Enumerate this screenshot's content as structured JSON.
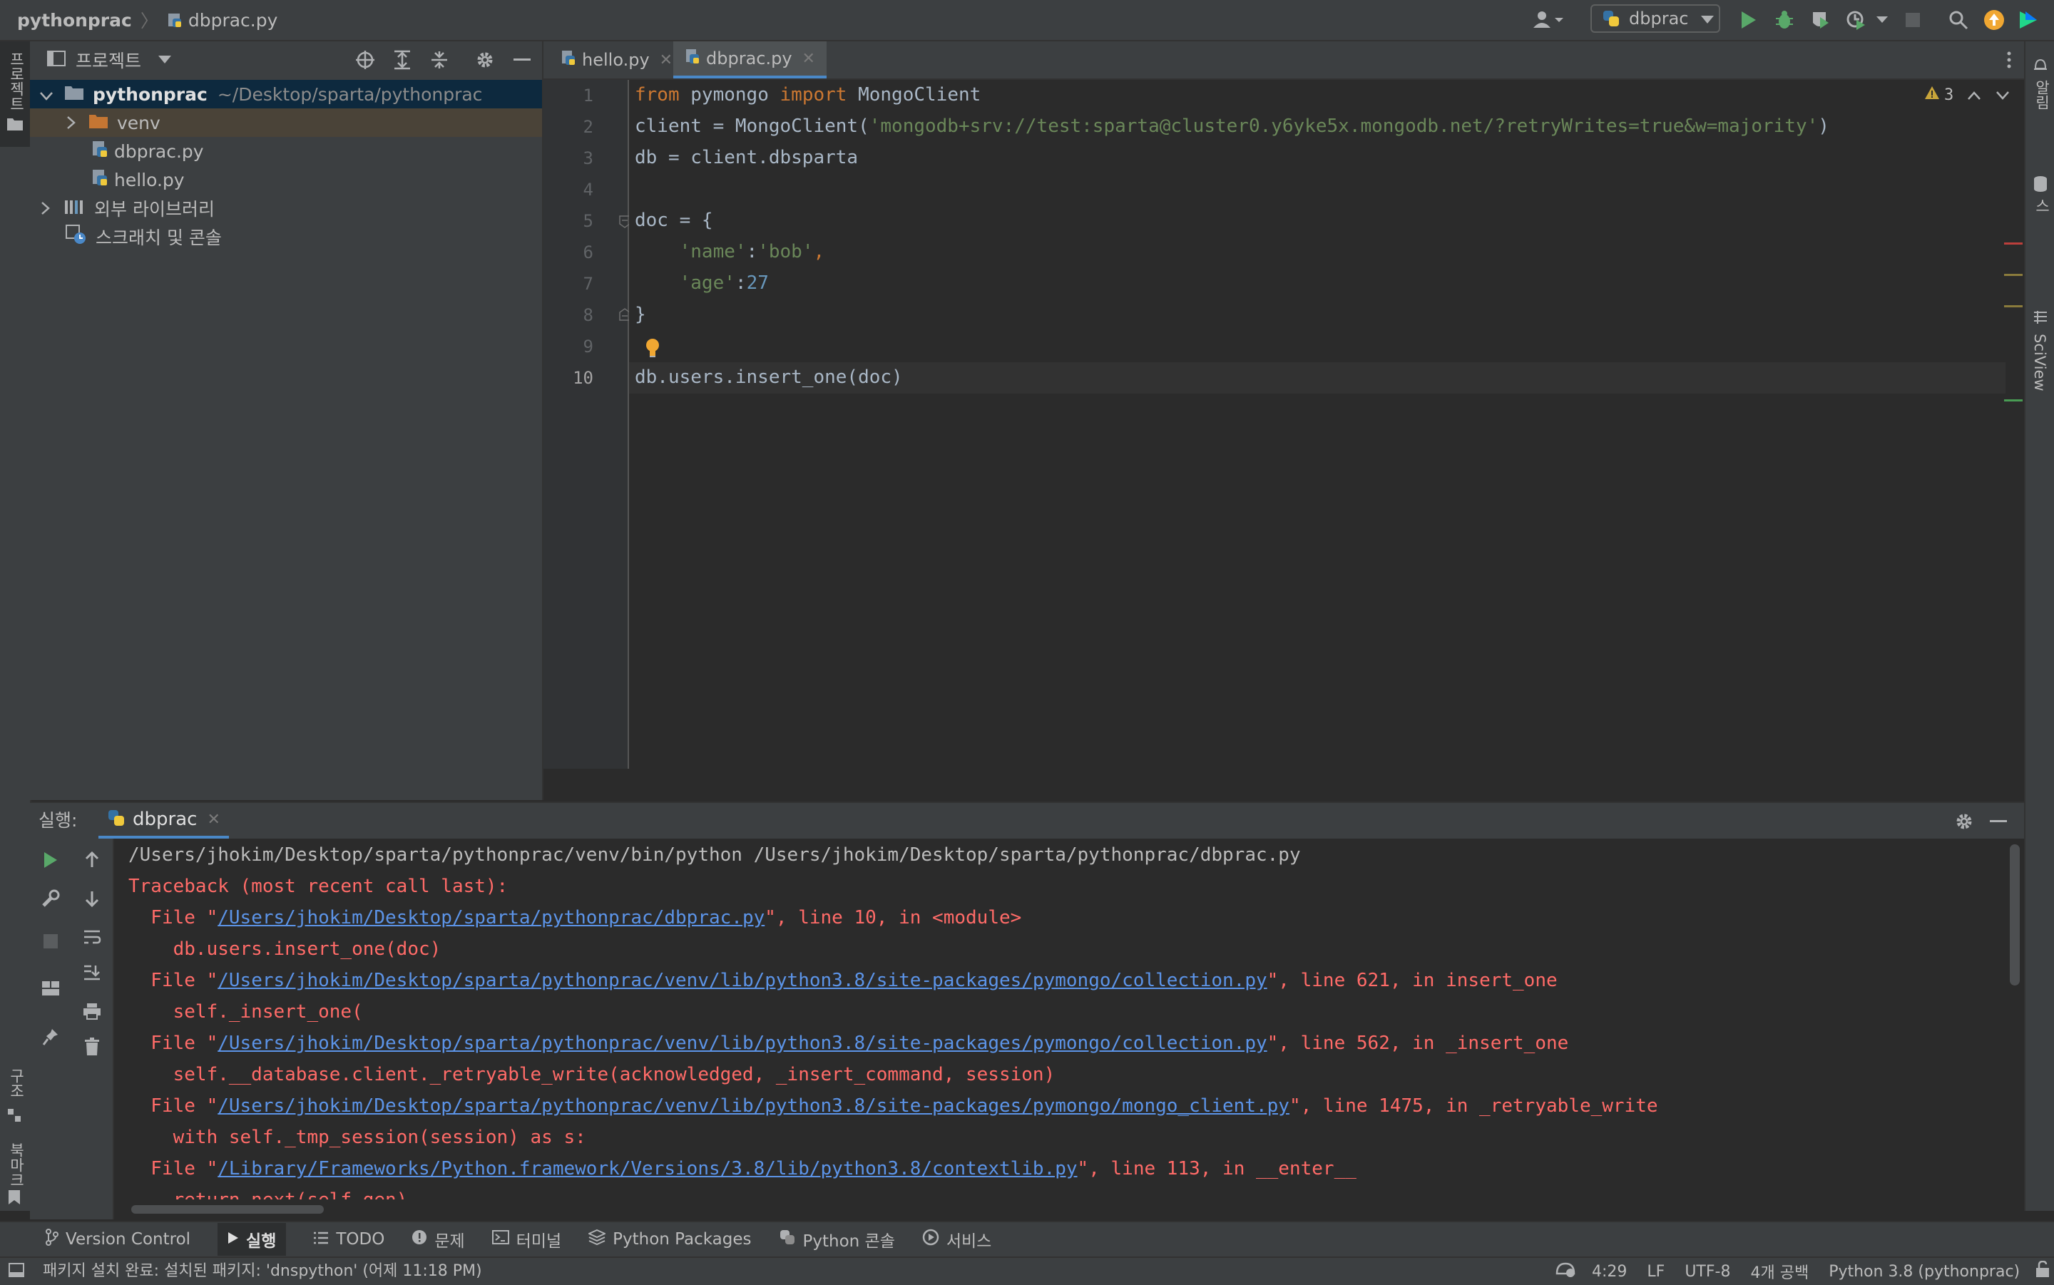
{
  "breadcrumb": {
    "project": "pythonprac",
    "file": "dbprac.py"
  },
  "toolbar": {
    "run_config": "dbprac"
  },
  "left_strip": {
    "project_label": "프로젝트",
    "structure_label": "구조",
    "bookmarks_label": "북마크"
  },
  "right_strip": {
    "notifications_label": "알림",
    "database_label": "데이터베이스",
    "sciview_label": "SciView"
  },
  "project_panel": {
    "title": "프로젝트",
    "tree": [
      {
        "label": "pythonprac",
        "path": "~/Desktop/sparta/pythonprac"
      },
      {
        "label": "venv"
      },
      {
        "label": "dbprac.py"
      },
      {
        "label": "hello.py"
      },
      {
        "label": "외부 라이브러리"
      },
      {
        "label": "스크래치 및 콘솔"
      }
    ]
  },
  "editor": {
    "tabs": [
      {
        "label": "hello.py"
      },
      {
        "label": "dbprac.py"
      }
    ],
    "warnings_count": "3",
    "line_numbers": [
      "1",
      "2",
      "3",
      "4",
      "5",
      "6",
      "7",
      "8",
      "9",
      "10"
    ],
    "code": {
      "l1": {
        "kw1": "from",
        "mid": " pymongo ",
        "kw2": "import",
        "end": " MongoClient"
      },
      "l2": {
        "pre": "client = MongoClient(",
        "str": "'mongodb+srv://test:sparta@cluster0.y6yke5x.mongodb.net/?retryWrites=true&w=majority'",
        "post": ")"
      },
      "l3": "db = client.dbsparta",
      "l5": "doc = {",
      "l6": {
        "key": "'name'",
        "sep": ":",
        "val": "'bob'",
        "post": ","
      },
      "l7": {
        "key": "'age'",
        "sep": ":",
        "val": "27"
      },
      "l8": "}",
      "l10": "db.users.insert_one(doc)"
    }
  },
  "run_panel": {
    "label": "실행:",
    "tab": "dbprac",
    "console": {
      "command": "/Users/jhokim/Desktop/sparta/pythonprac/venv/bin/python /Users/jhokim/Desktop/sparta/pythonprac/dbprac.py",
      "traceback": "Traceback (most recent call last):",
      "frames": [
        {
          "pre": "  File \"",
          "path": "/Users/jhokim/Desktop/sparta/pythonprac/dbprac.py",
          "post": "\", line 10, in <module>",
          "code": "    db.users.insert_one(doc)"
        },
        {
          "pre": "  File \"",
          "path": "/Users/jhokim/Desktop/sparta/pythonprac/venv/lib/python3.8/site-packages/pymongo/collection.py",
          "post": "\", line 621, in insert_one",
          "code": "    self._insert_one("
        },
        {
          "pre": "  File \"",
          "path": "/Users/jhokim/Desktop/sparta/pythonprac/venv/lib/python3.8/site-packages/pymongo/collection.py",
          "post": "\", line 562, in _insert_one",
          "code": "    self.__database.client._retryable_write(acknowledged, _insert_command, session)"
        },
        {
          "pre": "  File \"",
          "path": "/Users/jhokim/Desktop/sparta/pythonprac/venv/lib/python3.8/site-packages/pymongo/mongo_client.py",
          "post": "\", line 1475, in _retryable_write",
          "code": "    with self._tmp_session(session) as s:"
        },
        {
          "pre": "  File \"",
          "path": "/Library/Frameworks/Python.framework/Versions/3.8/lib/python3.8/contextlib.py",
          "post": "\", line 113, in __enter__",
          "code": "    return next(self.gen)"
        }
      ]
    }
  },
  "tool_tabs": [
    {
      "label": "Version Control"
    },
    {
      "label": "실행"
    },
    {
      "label": "TODO"
    },
    {
      "label": "문제"
    },
    {
      "label": "터미널"
    },
    {
      "label": "Python Packages"
    },
    {
      "label": "Python 콘솔"
    },
    {
      "label": "서비스"
    }
  ],
  "status_bar": {
    "message": "패키지 설치 완료: 설치된 패키지: 'dnspython' (어제 11:18 PM)",
    "position": "4:29",
    "line_ending": "LF",
    "encoding": "UTF-8",
    "indent": "4개 공백",
    "interpreter": "Python 3.8 (pythonprac)"
  },
  "colors": {
    "accent": "#4a88c7",
    "error": "#ff6b68",
    "link": "#5c94e8",
    "run_green": "#59a869",
    "folder_orange": "#c57633"
  }
}
